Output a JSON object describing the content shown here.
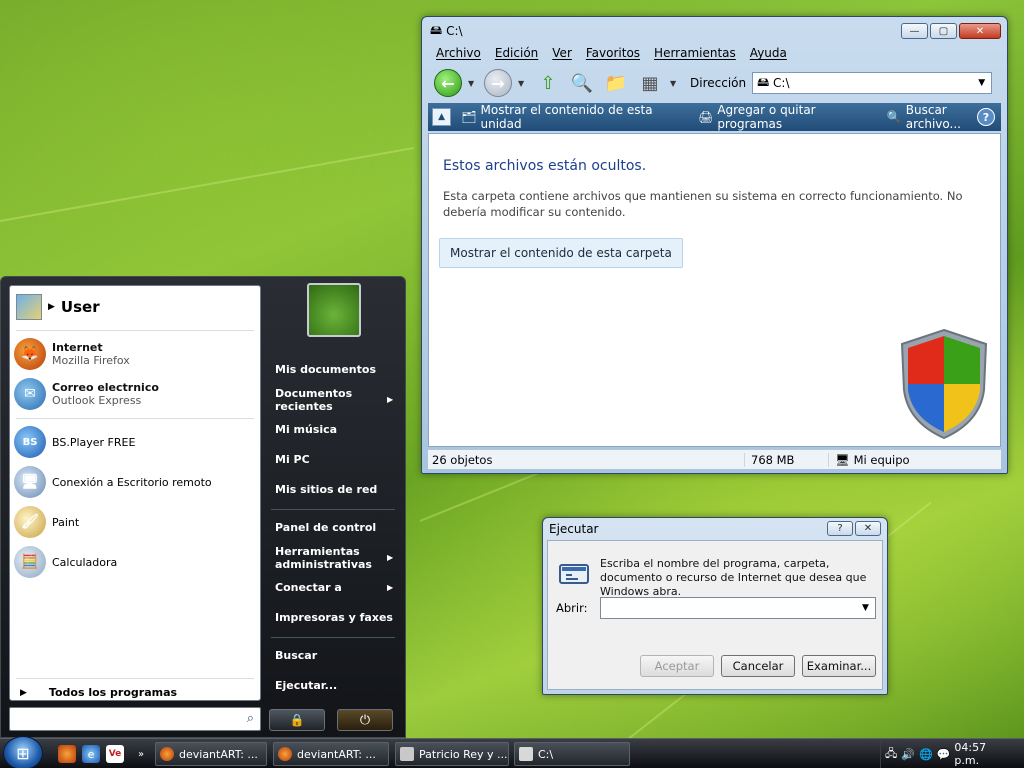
{
  "explorer": {
    "title": "C:\\",
    "menu": [
      "Archivo",
      "Edición",
      "Ver",
      "Favoritos",
      "Herramientas",
      "Ayuda"
    ],
    "address_label": "Dirección",
    "address_value": "C:\\",
    "tasks": {
      "show_drive": "Mostrar el contenido de esta unidad",
      "add_remove": "Agregar o quitar programas",
      "search": "Buscar archivo..."
    },
    "hidden_title": "Estos archivos están ocultos.",
    "hidden_desc": "Esta carpeta contiene archivos que mantienen su sistema en correcto funcionamiento. No debería modificar su contenido.",
    "show_folder_button": "Mostrar el contenido de esta carpeta",
    "status": {
      "objects": "26 objetos",
      "size": "768 MB",
      "location": "Mi equipo"
    }
  },
  "run_dialog": {
    "title": "Ejecutar",
    "description": "Escriba el nombre del programa, carpeta, documento o recurso de Internet que desea que Windows abra.",
    "open_label": "Abrir:",
    "open_value": "",
    "accept": "Aceptar",
    "cancel": "Cancelar",
    "browse": "Examinar..."
  },
  "start_menu": {
    "user": "User",
    "pinned": [
      {
        "main": "Internet",
        "sub": "Mozilla Firefox"
      },
      {
        "main": "Correo electrnico",
        "sub": "Outlook Express"
      }
    ],
    "recent": [
      "BS.Player FREE",
      "Conexión a Escritorio remoto",
      "Paint",
      "Calculadora"
    ],
    "all_programs": "Todos los programas",
    "right": {
      "documents": "Mis documentos",
      "recent_docs": "Documentos recientes",
      "music": "Mi música",
      "pc": "Mi PC",
      "network": "Mis sitios de red",
      "control_panel": "Panel de control",
      "admin_tools": "Herramientas administrativas",
      "connect": "Conectar a",
      "printers": "Impresoras y faxes",
      "search": "Buscar",
      "run": "Ejecutar..."
    }
  },
  "taskbar": {
    "tasks": [
      "deviantART: ...",
      "deviantART: ...",
      "Patricio Rey y ...",
      "C:\\"
    ],
    "clock": "04:57 p.m."
  },
  "colors": {
    "accent": "#1d3f8c",
    "taskpane": "#204c78",
    "taskbar": "#0c0e12"
  }
}
